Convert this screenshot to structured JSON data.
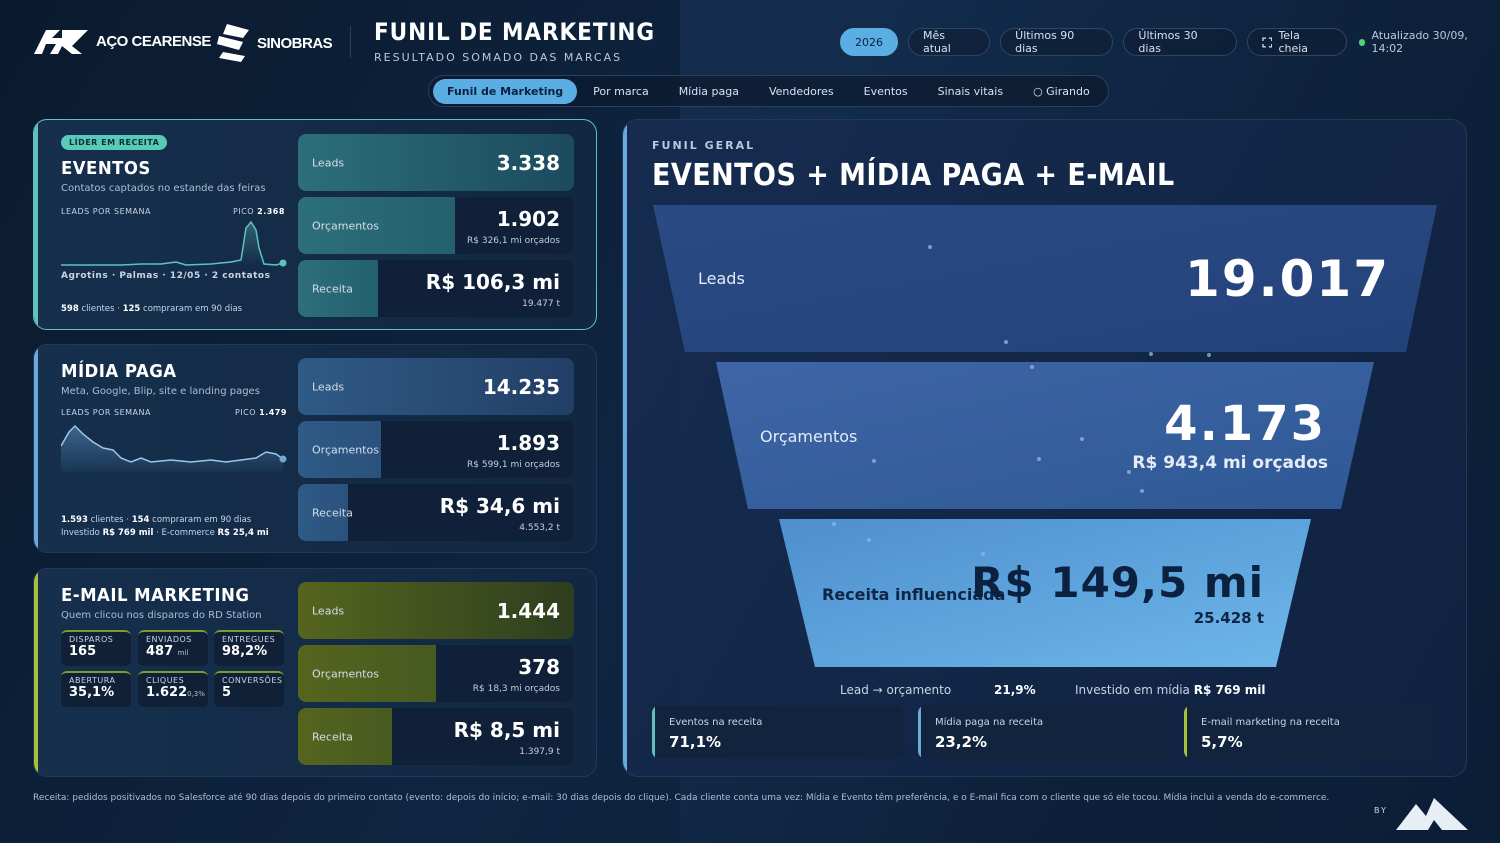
{
  "header": {
    "brand1": "AÇO CEARENSE",
    "brand2": "SINOBRAS",
    "title": "FUNIL DE MARKETING",
    "subtitle": "RESULTADO SOMADO DAS MARCAS",
    "filters": [
      "2026",
      "Mês atual",
      "Últimos 90 dias",
      "Últimos 30 dias"
    ],
    "fullscreen": "Tela cheia",
    "updated": "Atualizado 30/09, 14:02"
  },
  "tabs": [
    "Funil de Marketing",
    "Por marca",
    "Mídia paga",
    "Vendedores",
    "Eventos",
    "Sinais vitais",
    "○ Girando"
  ],
  "eventos": {
    "badge": "LÍDER EM RECEITA",
    "title": "EVENTOS",
    "subtitle": "Contatos captados no estande das feiras",
    "chart_label": "LEADS POR SEMANA",
    "peak_label": "PICO",
    "peak_value": "2.368",
    "event_note": "Agrotins · Palmas · 12/05 · 2 contatos",
    "clients": "598",
    "clients_text": "clientes ·",
    "bought": "125",
    "bought_text": "compraram em 90 dias",
    "leads_label": "Leads",
    "leads": "3.338",
    "orc_label": "Orçamentos",
    "orc": "1.902",
    "orc_sub": "R$ 326,1 mi orçados",
    "rec_label": "Receita",
    "rec": "R$ 106,3 mi",
    "rec_sub": "19.477 t",
    "colors": {
      "leads": "#2a6070",
      "orc": "#2a6a72",
      "rec": "#285a6a"
    }
  },
  "midia": {
    "title": "MÍDIA PAGA",
    "subtitle": "Meta, Google, Blip, site e landing pages",
    "chart_label": "LEADS POR SEMANA",
    "peak_label": "PICO",
    "peak_value": "1.479",
    "clients": "1.593",
    "clients_text": "clientes ·",
    "bought": "154",
    "bought_text": "compraram em 90 dias",
    "invest_text": "Investido",
    "invest": "R$ 769 mil",
    "ecom_text": "· E-commerce",
    "ecom": "R$ 25,4 mi",
    "leads_label": "Leads",
    "leads": "14.235",
    "orc_label": "Orçamentos",
    "orc": "1.893",
    "orc_sub": "R$ 599,1 mi orçados",
    "rec_label": "Receita",
    "rec": "R$ 34,6 mi",
    "rec_sub": "4.553,2 t"
  },
  "email": {
    "title": "E-MAIL MARKETING",
    "subtitle": "Quem clicou nos disparos do RD Station",
    "kpis": [
      {
        "k": "DISPAROS",
        "v": "165",
        "u": ""
      },
      {
        "k": "ENVIADOS",
        "v": "487",
        "u": "mil"
      },
      {
        "k": "ENTREGUES",
        "v": "98,2%",
        "u": ""
      },
      {
        "k": "ABERTURA",
        "v": "35,1%",
        "u": ""
      },
      {
        "k": "CLIQUES",
        "v": "1.622",
        "u": "0,3%"
      },
      {
        "k": "CONVERSÕES",
        "v": "5",
        "u": ""
      }
    ],
    "leads_label": "Leads",
    "leads": "1.444",
    "orc_label": "Orçamentos",
    "orc": "378",
    "orc_sub": "R$ 18,3 mi orçados",
    "rec_label": "Receita",
    "rec": "R$ 8,5 mi",
    "rec_sub": "1.397,9 t"
  },
  "funnel": {
    "overline": "FUNIL GERAL",
    "title": "EVENTOS + MÍDIA PAGA + E-MAIL",
    "leads_label": "Leads",
    "leads": "19.017",
    "orc_label": "Orçamentos",
    "orc": "4.173",
    "orc_sub": "R$ 943,4 mi orçados",
    "rec_label": "Receita influenciada",
    "rec": "R$ 149,5 mi",
    "rec_sub": "25.428 t",
    "conv_label": "Lead → orçamento",
    "conv": "21,9%",
    "invest_label": "Investido em mídia",
    "invest": "R$ 769 mil",
    "shares": [
      {
        "k": "Eventos na receita",
        "v": "71,1%",
        "color": "#5fc2c0"
      },
      {
        "k": "Mídia paga na receita",
        "v": "23,2%",
        "color": "#6aa9d8"
      },
      {
        "k": "E-mail marketing na receita",
        "v": "5,7%",
        "color": "#a6c23a"
      }
    ]
  },
  "footnote": "Receita: pedidos positivados no Salesforce até 90 dias depois do primeiro contato (evento: depois do início; e-mail: 30 dias depois do clique). Cada cliente conta uma vez: Mídia e Evento têm preferência, e o E-mail fica com o cliente que só ele tocou. Mídia inclui a venda do e-commerce.",
  "by": "BY"
}
